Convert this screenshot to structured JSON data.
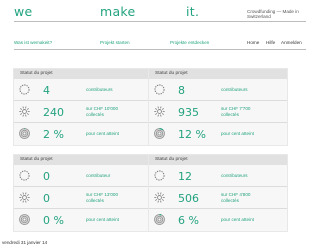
{
  "header": {
    "logo_words": [
      "we",
      "make",
      "it."
    ],
    "tagline": "Crowdfunding — Made in Switzerland"
  },
  "nav": {
    "items": [
      "Was ist wemakeit?",
      "Projekt starten",
      "Projekte entdecken"
    ],
    "right": [
      "Home",
      "Hilfe",
      "Anmelden"
    ]
  },
  "panels": [
    {
      "title": "Statut du projet",
      "rows": [
        {
          "value": "4",
          "label": "contributeurs"
        },
        {
          "value": "240",
          "label": "sur CHF 10'000 collectés"
        },
        {
          "value": "2 %",
          "label": "pour cent atteint",
          "progress": 0.02
        }
      ]
    },
    {
      "title": "Statut du projet",
      "rows": [
        {
          "value": "8",
          "label": "contributeurs"
        },
        {
          "value": "935",
          "label": "sur CHF 7'700 collectés"
        },
        {
          "value": "12 %",
          "label": "pour cent atteint",
          "progress": 0.12
        }
      ]
    },
    {
      "title": "Statut du projet",
      "rows": [
        {
          "value": "0",
          "label": "contributeur"
        },
        {
          "value": "0",
          "label": "sur CHF 13'000 collectés"
        },
        {
          "value": "0 %",
          "label": "pour cent atteint",
          "progress": 0.0
        }
      ]
    },
    {
      "title": "Statut du projet",
      "rows": [
        {
          "value": "12",
          "label": "contributeurs"
        },
        {
          "value": "506",
          "label": "sur CHF 4'800 collectés"
        },
        {
          "value": "6 %",
          "label": "pour cent atteint",
          "progress": 0.06
        }
      ]
    }
  ],
  "footer": {
    "timestamp": "vendredi 31 janvier 14"
  },
  "colors": {
    "accent": "#23a37f",
    "panel_bg": "#f7f7f7",
    "header_bg": "#e1e1e1"
  },
  "icons": {
    "row1": "dashed-circle-icon",
    "row2": "money-circle-icon",
    "row3": "progress-ring-icon"
  }
}
